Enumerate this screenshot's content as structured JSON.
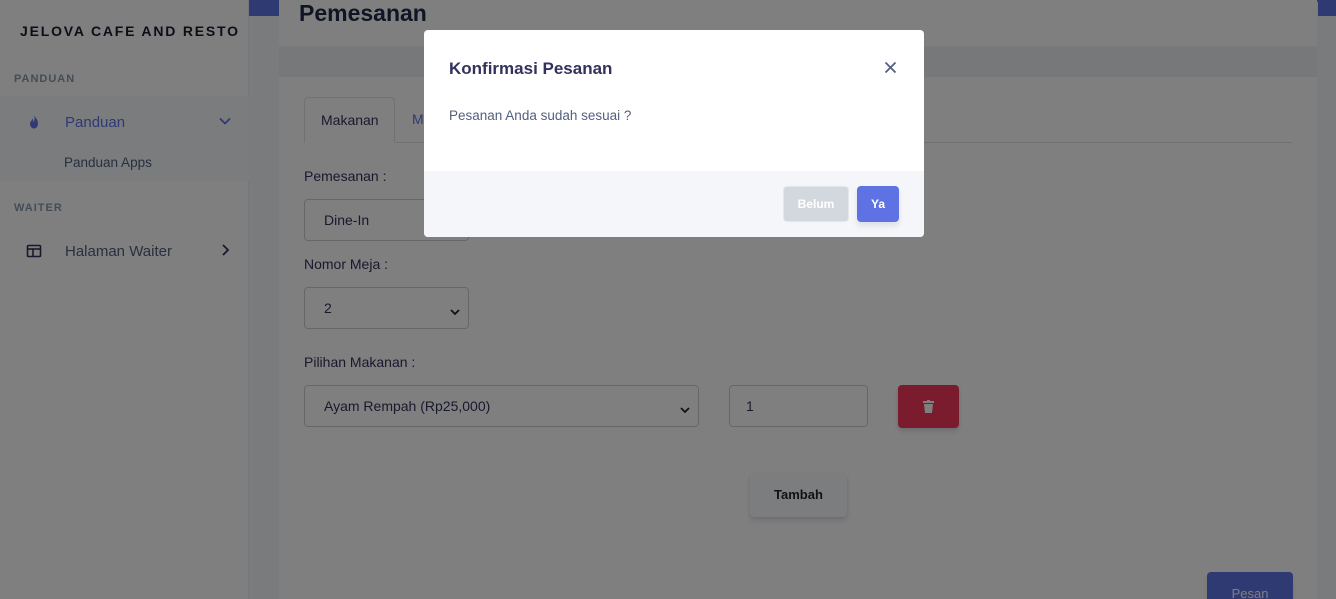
{
  "sidebar": {
    "brand": "JELOVA CAFE AND RESTO",
    "sections": [
      {
        "title": "PANDUAN"
      },
      {
        "title": "WAITER"
      }
    ],
    "items": [
      {
        "label": "Panduan",
        "icon": "flame-icon"
      },
      {
        "label": "Halaman Waiter",
        "icon": "table-icon"
      }
    ],
    "sub_items": [
      {
        "label": "Panduan Apps"
      }
    ]
  },
  "page": {
    "title": "Pemesanan"
  },
  "tabs": [
    {
      "label": "Makanan"
    },
    {
      "label": "M"
    }
  ],
  "form": {
    "order_type_label": "Pemesanan :",
    "order_type_value": "Dine-In",
    "table_label": "Nomor Meja :",
    "table_value": "2",
    "food_label": "Pilihan Makanan :",
    "food_value": "Ayam Rempah (Rp25,000)",
    "quantity_value": "1",
    "add_label": "Tambah",
    "order_label": "Pesan"
  },
  "modal": {
    "title": "Konfirmasi Pesanan",
    "body": "Pesanan Anda sudah sesuai ?",
    "cancel_label": "Belum",
    "confirm_label": "Ya"
  },
  "colors": {
    "primary": "#5e72e4",
    "danger": "#f5365c"
  }
}
